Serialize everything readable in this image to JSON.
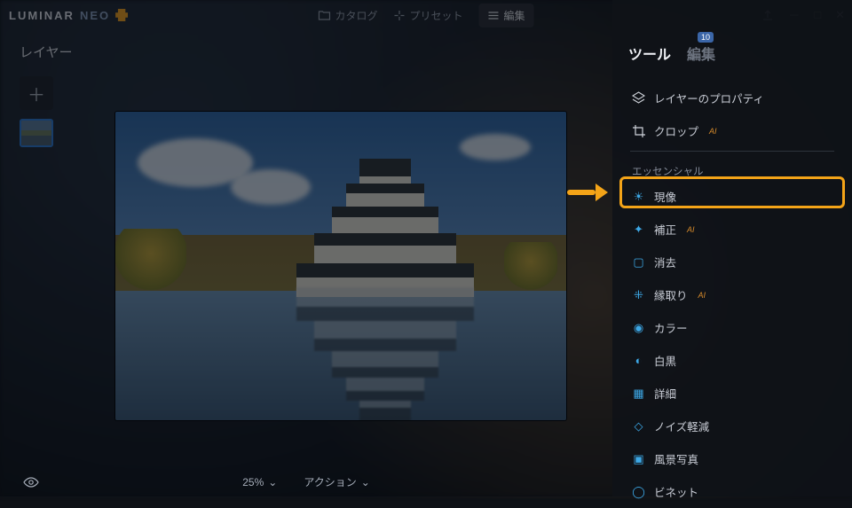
{
  "app": {
    "brand": "LUMINAR",
    "brand_suffix": "NEO"
  },
  "topnav": {
    "catalog": "カタログ",
    "presets": "プリセット",
    "edit": "編集"
  },
  "layers": {
    "title": "レイヤー"
  },
  "footer": {
    "zoom": "25%",
    "action": "アクション"
  },
  "panel": {
    "tab_tools": "ツール",
    "tab_edits": "編集",
    "badge": "10",
    "layer_props": "レイヤーのプロパティ",
    "crop": "クロップ",
    "section_essentials": "エッセンシャル",
    "tools": {
      "develop": "現像",
      "enhance": "補正",
      "erase": "消去",
      "structure": "縁取り",
      "color": "カラー",
      "bw": "白黒",
      "details": "詳細",
      "denoise": "ノイズ軽減",
      "landscape": "風景写真",
      "vignette": "ビネット"
    },
    "ai_badge": "AI"
  },
  "colors": {
    "accent": "#f4a418",
    "icon_blue": "#3da8e6"
  }
}
